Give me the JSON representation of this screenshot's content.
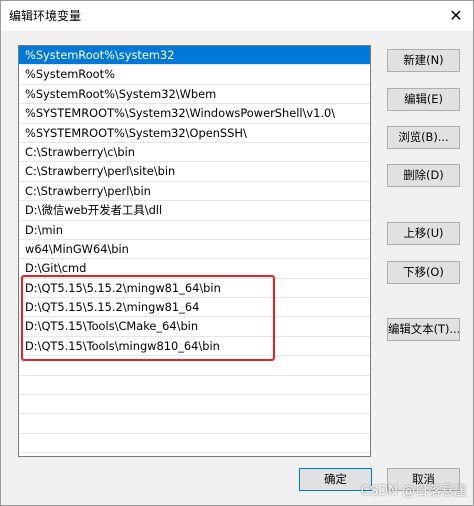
{
  "window": {
    "title": "编辑环境变量",
    "close_glyph": "✕"
  },
  "paths": [
    "%SystemRoot%\\system32",
    "%SystemRoot%",
    "%SystemRoot%\\System32\\Wbem",
    "%SYSTEMROOT%\\System32\\WindowsPowerShell\\v1.0\\",
    "%SYSTEMROOT%\\System32\\OpenSSH\\",
    "C:\\Strawberry\\c\\bin",
    "C:\\Strawberry\\perl\\site\\bin",
    "C:\\Strawberry\\perl\\bin",
    "D:\\微信web开发者工具\\dll",
    "D:\\min",
    "w64\\MinGW64\\bin",
    "D:\\Git\\cmd",
    "D:\\QT5.15\\5.15.2\\mingw81_64\\bin",
    "D:\\QT5.15\\5.15.2\\mingw81_64",
    "D:\\QT5.15\\Tools\\CMake_64\\bin",
    "D:\\QT5.15\\Tools\\mingw810_64\\bin",
    "",
    "",
    "",
    "",
    ""
  ],
  "selected_index": 0,
  "buttons": {
    "new": "新建(N)",
    "edit": "编辑(E)",
    "browse": "浏览(B)...",
    "delete": "删除(D)",
    "move_up": "上移(U)",
    "move_down": "下移(O)",
    "edit_text": "编辑文本(T)...",
    "ok": "确定",
    "cancel": "取消"
  },
  "watermark": "CSDN @日落悬崖",
  "colors": {
    "selection": "#0078d7",
    "highlight_box": "#e8202a"
  }
}
